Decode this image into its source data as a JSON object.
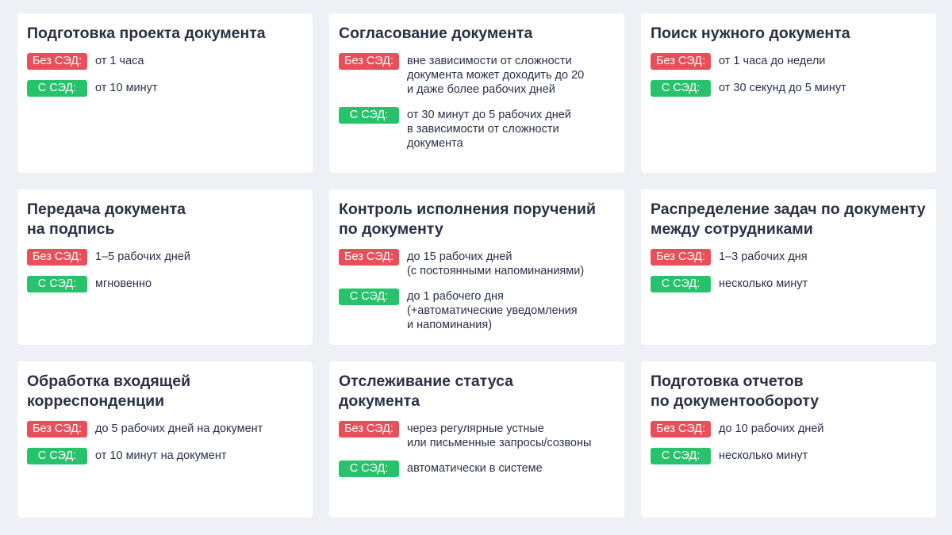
{
  "labels": {
    "without": "Без СЭД:",
    "with": "С СЭД:"
  },
  "colors": {
    "background": "#eef0f5",
    "card": "#ffffff",
    "without_badge": "#e84f5a",
    "with_badge": "#27c26b",
    "text": "#2a3147"
  },
  "cards": [
    {
      "title": "Подготовка проекта документа",
      "without": "от 1 часа",
      "with": "от 10 минут"
    },
    {
      "title": "Согласование документа",
      "without": "вне зависимости от сложности\nдокумента может доходить до 20\nи даже более рабочих дней",
      "with": "от 30 минут до 5 рабочих дней\nв зависимости от сложности\nдокумента"
    },
    {
      "title": "Поиск нужного документа",
      "without": "от 1 часа до недели",
      "with": "от 30 секунд  до 5 минут"
    },
    {
      "title": "Передача документа\nна подпись",
      "without": "1–5 рабочих дней",
      "with": "мгновенно"
    },
    {
      "title": "Контроль исполнения поручений\nпо документу",
      "without": "до 15 рабочих дней\n(с постоянными напоминаниями)",
      "with": "до 1 рабочего дня\n(+автоматические уведомления\nи напоминания)"
    },
    {
      "title": "Распределение задач по документу\nмежду сотрудниками",
      "without": "1–3 рабочих дня",
      "with": "несколько минут"
    },
    {
      "title": "Обработка входящей\nкорреспонденции",
      "without": "до 5 рабочих дней на документ",
      "with": "от 10 минут на документ"
    },
    {
      "title": "Отслеживание статуса\nдокумента",
      "without": "через регулярные устные\nили письменные запросы/созвоны",
      "with": "автоматически в системе"
    },
    {
      "title": "Подготовка отчетов\nпо документообороту",
      "without": "до 10 рабочих дней",
      "with": "несколько минут"
    }
  ]
}
